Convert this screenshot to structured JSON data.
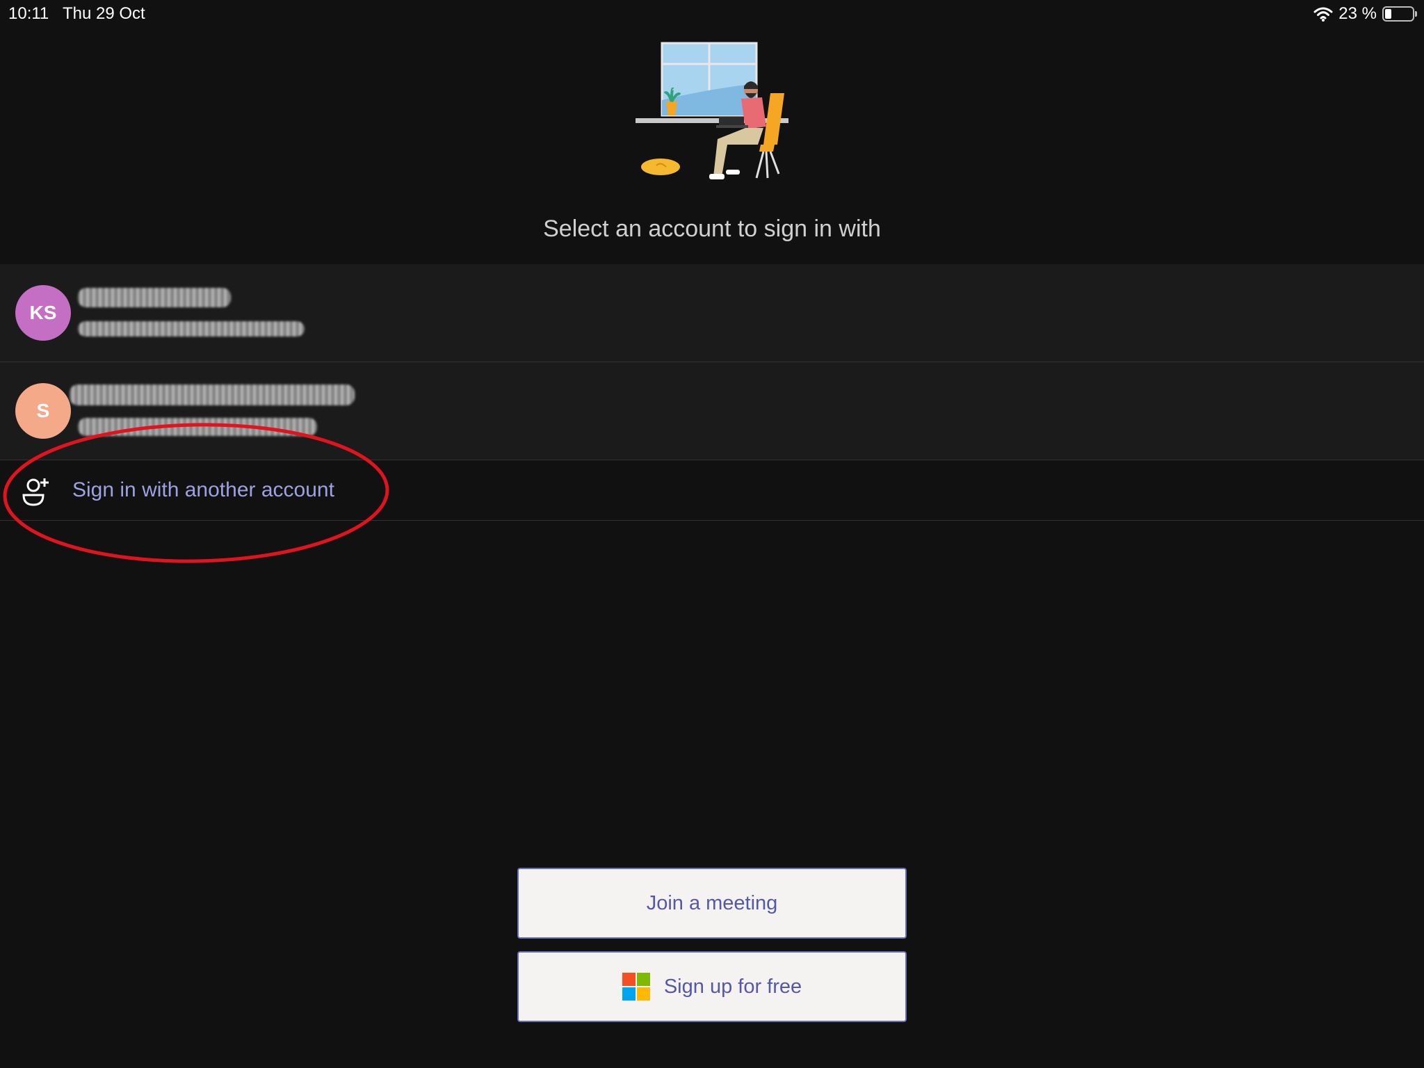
{
  "status_bar": {
    "time": "10:11",
    "date": "Thu 29 Oct",
    "battery": "23 %",
    "battery_level": 0.23,
    "wifi_icon": "wifi-icon"
  },
  "heading": "Select an account to sign in with",
  "accounts": [
    {
      "initials": "KS",
      "avatar_color": "#c46fc4"
    },
    {
      "initials": "S",
      "avatar_color": "#f4a989"
    }
  ],
  "another_account": {
    "icon": "person-add-icon",
    "label": "Sign in with another account"
  },
  "buttons": {
    "join_label": "Join a meeting",
    "signup_label": "Sign up for free",
    "signup_icon": "microsoft-logo-icon"
  },
  "colors": {
    "background": "#111111",
    "accent": "#9ea2e0",
    "button_text": "#5558a8",
    "annotation": "#e0141e",
    "ms_logo": [
      "#f25022",
      "#7fba00",
      "#00a4ef",
      "#ffb900"
    ]
  }
}
